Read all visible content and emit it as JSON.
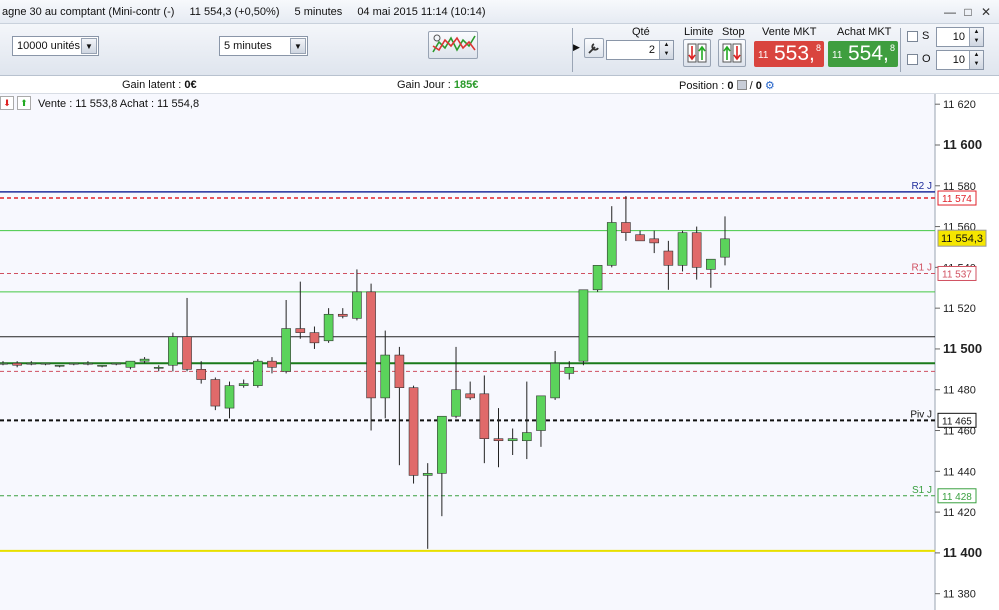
{
  "window": {
    "title_instrument": "agne 30 au comptant (Mini-contr (-)",
    "title_price": "11 554,3 (+0,50%)",
    "title_period": "5 minutes",
    "title_datetime": "04 mai 2015 11:14 (10:14)",
    "minimize_glyph": "—",
    "maximize_glyph": "□",
    "close_glyph": "✕"
  },
  "toolbar": {
    "units_value": "10000 unités",
    "timeframe_value": "5 minutes",
    "qty_label": "Qté",
    "qty_value": "2",
    "limit_label": "Limite",
    "stop_label": "Stop",
    "sell_label": "Vente MKT",
    "sell_price_small": "11",
    "sell_price_big": "553,",
    "sell_price_sup": "8",
    "buy_label": "Achat MKT",
    "buy_price_small": "11",
    "buy_price_big": "554,",
    "buy_price_sup": "8",
    "s_label": "S",
    "s_value": "10",
    "o_label": "O",
    "o_value": "10",
    "sell_color": "#d9443e",
    "buy_color": "#3f9e3f"
  },
  "infobar": {
    "gain_latent_label": "Gain latent :",
    "gain_latent_value": "0€",
    "gain_jour_label": "Gain Jour :",
    "gain_jour_value": "185€",
    "position_label": "Position :",
    "position_value_a": "0",
    "position_sep": "/",
    "position_value_b": "0"
  },
  "quote_line": {
    "text": "Vente : 11 553,8  Achat : 11 554,8"
  },
  "chart_data": {
    "type": "candlestick",
    "ylim": [
      11372,
      11625
    ],
    "yticks": [
      {
        "v": 11620,
        "label": "11 620",
        "bold": false
      },
      {
        "v": 11600,
        "label": "11 600",
        "bold": true
      },
      {
        "v": 11580,
        "label": "11 580",
        "bold": false
      },
      {
        "v": 11560,
        "label": "11 560",
        "bold": false
      },
      {
        "v": 11540,
        "label": "11 540",
        "bold": false
      },
      {
        "v": 11520,
        "label": "11 520",
        "bold": false
      },
      {
        "v": 11500,
        "label": "11 500",
        "bold": true
      },
      {
        "v": 11480,
        "label": "11 480",
        "bold": false
      },
      {
        "v": 11460,
        "label": "11 460",
        "bold": false
      },
      {
        "v": 11440,
        "label": "11 440",
        "bold": false
      },
      {
        "v": 11420,
        "label": "11 420",
        "bold": false
      },
      {
        "v": 11400,
        "label": "11 400",
        "bold": true
      },
      {
        "v": 11380,
        "label": "11 380",
        "bold": false
      }
    ],
    "levels": [
      {
        "name": "R2 J",
        "value": 11577,
        "color": "#1f2d9c",
        "dash": false,
        "width": 1.5
      },
      {
        "name": "",
        "value": 11574,
        "color": "#e0222a",
        "dash": true,
        "width": 1.5,
        "tag": "11 574"
      },
      {
        "name": "",
        "value": 11558,
        "color": "#44c844",
        "dash": false,
        "width": 1
      },
      {
        "name": "R1 J",
        "value": 11537,
        "color": "#d05060",
        "dash": true,
        "width": 1,
        "tag": "11 537"
      },
      {
        "name": "",
        "value": 11528,
        "color": "#44c844",
        "dash": false,
        "width": 1
      },
      {
        "name": "",
        "value": 11506,
        "color": "#222222",
        "dash": false,
        "width": 1
      },
      {
        "name": "",
        "value": 11493,
        "color": "#1a7a1a",
        "dash": false,
        "width": 2
      },
      {
        "name": "",
        "value": 11489,
        "color": "#d05060",
        "dash": true,
        "width": 1
      },
      {
        "name": "Piv J",
        "value": 11465,
        "color": "#111111",
        "dash": true,
        "width": 2,
        "tag": "11 465"
      },
      {
        "name": "S1 J",
        "value": 11428,
        "color": "#3aa040",
        "dash": true,
        "width": 1,
        "tag": "11 428"
      },
      {
        "name": "",
        "value": 11401,
        "color": "#e8e000",
        "dash": false,
        "width": 2
      }
    ],
    "current_price": {
      "value": 11554.3,
      "label": "11 554,3"
    },
    "candles": [
      {
        "o": 11493,
        "h": 11494,
        "l": 11492,
        "c": 11493
      },
      {
        "o": 11493,
        "h": 11494,
        "l": 11491,
        "c": 11492
      },
      {
        "o": 11493,
        "h": 11494,
        "l": 11492,
        "c": 11493
      },
      {
        "o": 11493,
        "h": 11493,
        "l": 11492,
        "c": 11493
      },
      {
        "o": 11492,
        "h": 11492,
        "l": 11491,
        "c": 11492
      },
      {
        "o": 11493,
        "h": 11493,
        "l": 11492,
        "c": 11493
      },
      {
        "o": 11493,
        "h": 11494,
        "l": 11492,
        "c": 11493
      },
      {
        "o": 11492,
        "h": 11492,
        "l": 11491,
        "c": 11492
      },
      {
        "o": 11493,
        "h": 11493,
        "l": 11492,
        "c": 11493
      },
      {
        "o": 11491,
        "h": 11494,
        "l": 11490,
        "c": 11494
      },
      {
        "o": 11494,
        "h": 11496,
        "l": 11493,
        "c": 11495
      },
      {
        "o": 11491,
        "h": 11492,
        "l": 11489,
        "c": 11491
      },
      {
        "o": 11492,
        "h": 11508,
        "l": 11489,
        "c": 11506
      },
      {
        "o": 11506,
        "h": 11525,
        "l": 11489,
        "c": 11490
      },
      {
        "o": 11490,
        "h": 11494,
        "l": 11483,
        "c": 11485
      },
      {
        "o": 11485,
        "h": 11486,
        "l": 11470,
        "c": 11472
      },
      {
        "o": 11471,
        "h": 11484,
        "l": 11466,
        "c": 11482
      },
      {
        "o": 11482,
        "h": 11485,
        "l": 11481,
        "c": 11483
      },
      {
        "o": 11482,
        "h": 11495,
        "l": 11481,
        "c": 11494
      },
      {
        "o": 11494,
        "h": 11496,
        "l": 11488,
        "c": 11491
      },
      {
        "o": 11489,
        "h": 11524,
        "l": 11488,
        "c": 11510
      },
      {
        "o": 11510,
        "h": 11533,
        "l": 11505,
        "c": 11508
      },
      {
        "o": 11508,
        "h": 11511,
        "l": 11500,
        "c": 11503
      },
      {
        "o": 11504,
        "h": 11520,
        "l": 11503,
        "c": 11517
      },
      {
        "o": 11517,
        "h": 11520,
        "l": 11515,
        "c": 11516
      },
      {
        "o": 11515,
        "h": 11539,
        "l": 11514,
        "c": 11528
      },
      {
        "o": 11528,
        "h": 11532,
        "l": 11460,
        "c": 11476
      },
      {
        "o": 11476,
        "h": 11509,
        "l": 11466,
        "c": 11497
      },
      {
        "o": 11497,
        "h": 11501,
        "l": 11443,
        "c": 11481
      },
      {
        "o": 11481,
        "h": 11482,
        "l": 11434,
        "c": 11438
      },
      {
        "o": 11438,
        "h": 11444,
        "l": 11402,
        "c": 11439
      },
      {
        "o": 11439,
        "h": 11446,
        "l": 11418,
        "c": 11467
      },
      {
        "o": 11467,
        "h": 11501,
        "l": 11466,
        "c": 11480
      },
      {
        "o": 11478,
        "h": 11484,
        "l": 11475,
        "c": 11476
      },
      {
        "o": 11478,
        "h": 11487,
        "l": 11444,
        "c": 11456
      },
      {
        "o": 11456,
        "h": 11471,
        "l": 11442,
        "c": 11455
      },
      {
        "o": 11455,
        "h": 11461,
        "l": 11448,
        "c": 11456
      },
      {
        "o": 11455,
        "h": 11484,
        "l": 11446,
        "c": 11459
      },
      {
        "o": 11460,
        "h": 11473,
        "l": 11452,
        "c": 11477
      },
      {
        "o": 11476,
        "h": 11499,
        "l": 11475,
        "c": 11493
      },
      {
        "o": 11488,
        "h": 11494,
        "l": 11485,
        "c": 11491
      },
      {
        "o": 11494,
        "h": 11525,
        "l": 11492,
        "c": 11529
      },
      {
        "o": 11529,
        "h": 11541,
        "l": 11528,
        "c": 11541
      },
      {
        "o": 11541,
        "h": 11570,
        "l": 11540,
        "c": 11562
      },
      {
        "o": 11562,
        "h": 11575,
        "l": 11553,
        "c": 11557
      },
      {
        "o": 11556,
        "h": 11558,
        "l": 11553,
        "c": 11553
      },
      {
        "o": 11554,
        "h": 11558,
        "l": 11547,
        "c": 11552
      },
      {
        "o": 11548,
        "h": 11553,
        "l": 11529,
        "c": 11541
      },
      {
        "o": 11541,
        "h": 11558,
        "l": 11538,
        "c": 11557
      },
      {
        "o": 11557,
        "h": 11560,
        "l": 11534,
        "c": 11540
      },
      {
        "o": 11539,
        "h": 11543,
        "l": 11530,
        "c": 11544
      },
      {
        "o": 11545,
        "h": 11565,
        "l": 11541,
        "c": 11554
      }
    ]
  },
  "colors": {
    "bull": "#5bd35b",
    "bear": "#e06a6a",
    "wick": "#222222",
    "chart_bg": "#f7f8fe"
  }
}
